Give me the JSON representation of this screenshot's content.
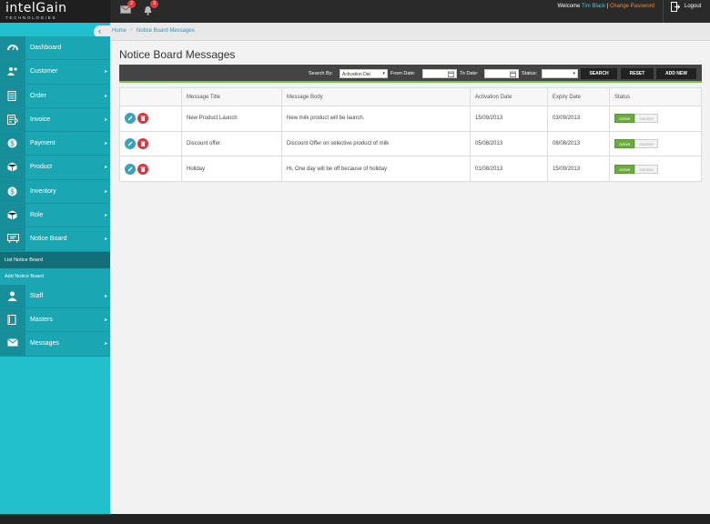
{
  "brand": {
    "name_part1": "intel",
    "name_part2": "Gain",
    "sub": "TECHNOLOGIES"
  },
  "notifications": {
    "mail_count": "2",
    "bell_count": "3"
  },
  "header": {
    "welcome": "Welcome",
    "user": "Tim Black",
    "sep": " | ",
    "change_password": "Change Password",
    "logout": "Logout"
  },
  "sidebar": {
    "items": [
      {
        "label": "Dashboard",
        "icon": "dashboard-icon"
      },
      {
        "label": "Customer",
        "icon": "customer-icon"
      },
      {
        "label": "Order",
        "icon": "order-icon"
      },
      {
        "label": "Invoice",
        "icon": "invoice-icon"
      },
      {
        "label": "Payment",
        "icon": "payment-icon"
      },
      {
        "label": "Product",
        "icon": "product-icon"
      },
      {
        "label": "Inventory",
        "icon": "inventory-icon"
      },
      {
        "label": "Role",
        "icon": "role-icon"
      },
      {
        "label": "Notice Board",
        "icon": "notice-board-icon"
      }
    ],
    "subitems": [
      {
        "label": "List Notice Board"
      },
      {
        "label": "Add Notice Board"
      }
    ],
    "items2": [
      {
        "label": "Staff",
        "icon": "staff-icon"
      },
      {
        "label": "Masters",
        "icon": "masters-icon"
      },
      {
        "label": "Messages",
        "icon": "messages-icon"
      }
    ]
  },
  "breadcrumb": {
    "home": "Home",
    "current": "Notice Board Messages"
  },
  "page": {
    "title": "Notice Board Messages"
  },
  "search": {
    "search_by_label": "Search By:",
    "search_by_value": "Activation Dat",
    "from_label": "From Date:",
    "to_label": "To Date:",
    "status_label": "Status:",
    "search_btn": "SEARCH",
    "reset_btn": "RESET",
    "add_btn": "ADD NEW"
  },
  "table": {
    "headers": [
      "",
      "Message Title",
      "Message Body",
      "Activation Date",
      "Expiry Date",
      "Status"
    ],
    "toggle_on": "Active",
    "toggle_off": "Inactive",
    "rows": [
      {
        "title": "New Product Launch",
        "body": "New milk product will be launch.",
        "activation": "15/09/2013",
        "expiry": "03/09/2013"
      },
      {
        "title": "Discount offer",
        "body": "Discount Offer on selective product of milk",
        "activation": "05/08/2013",
        "expiry": "08/08/2013"
      },
      {
        "title": "Holiday",
        "body": "Hi, One day will be off because of holiday",
        "activation": "01/08/2013",
        "expiry": "15/09/2013"
      }
    ]
  },
  "colors": {
    "sidebar": "#21c0cc",
    "accent": "#1aa6b3",
    "active": "#6aaa3e",
    "delete": "#d9363e"
  }
}
